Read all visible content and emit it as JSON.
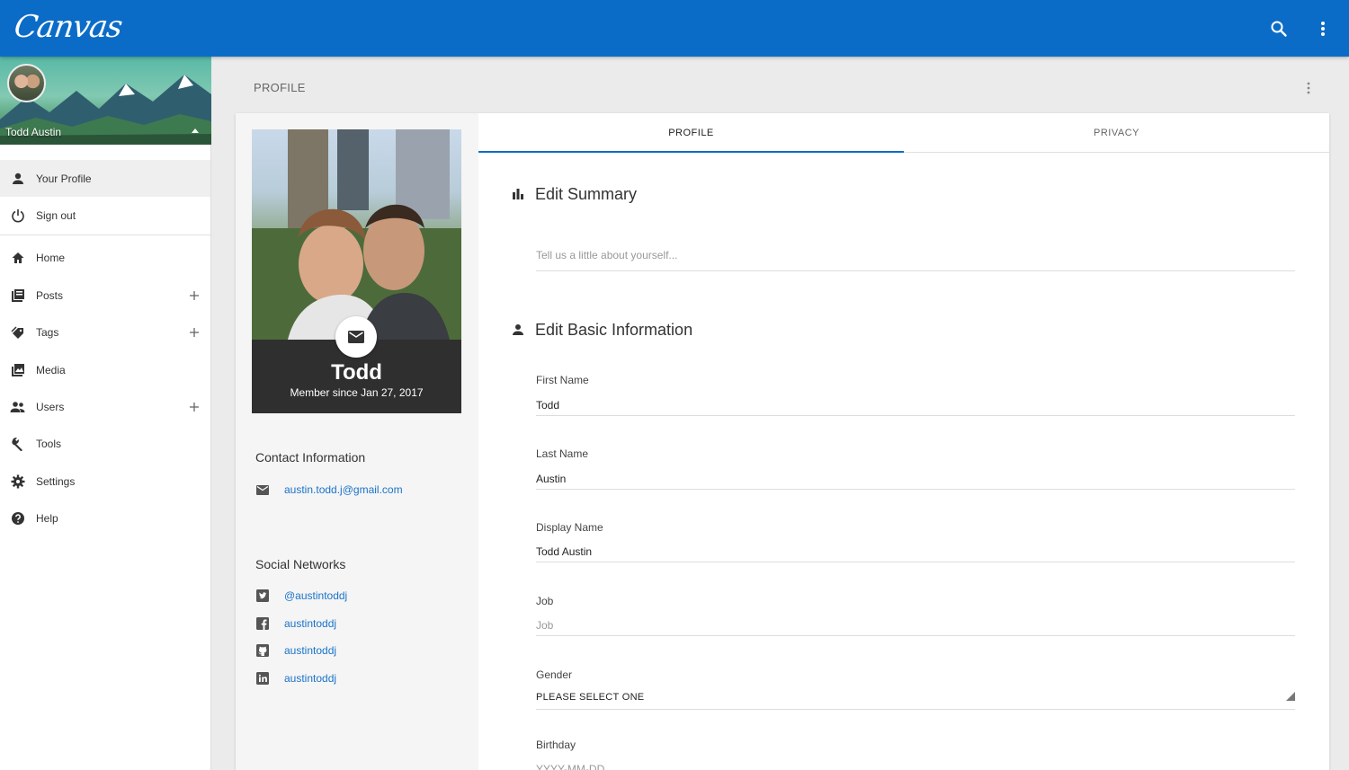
{
  "app": {
    "logo": "Canvas"
  },
  "icons": {
    "search": "search-icon",
    "more": "more-vert-icon"
  },
  "sidebar": {
    "user_name": "Todd Austin",
    "account": [
      {
        "label": "Your Profile",
        "icon": "person-icon",
        "active": true
      },
      {
        "label": "Sign out",
        "icon": "power-icon"
      }
    ],
    "items": [
      {
        "label": "Home",
        "icon": "home-icon"
      },
      {
        "label": "Posts",
        "icon": "posts-icon",
        "add": true
      },
      {
        "label": "Tags",
        "icon": "tags-icon",
        "add": true
      },
      {
        "label": "Media",
        "icon": "media-icon"
      },
      {
        "label": "Users",
        "icon": "users-icon",
        "add": true
      },
      {
        "label": "Tools",
        "icon": "wrench-icon"
      },
      {
        "label": "Settings",
        "icon": "gear-icon"
      },
      {
        "label": "Help",
        "icon": "help-icon"
      }
    ]
  },
  "page": {
    "title": "PROFILE"
  },
  "profile_card": {
    "name": "Todd",
    "member_since": "Member since Jan 27, 2017",
    "contact_heading": "Contact Information",
    "email": "austin.todd.j@gmail.com",
    "social_heading": "Social Networks",
    "social": [
      {
        "network": "twitter",
        "icon": "twitter-icon",
        "handle": "@austintoddj"
      },
      {
        "network": "facebook",
        "icon": "facebook-icon",
        "handle": "austintoddj"
      },
      {
        "network": "github",
        "icon": "github-icon",
        "handle": "austintoddj"
      },
      {
        "network": "linkedin",
        "icon": "linkedin-icon",
        "handle": "austintoddj"
      }
    ]
  },
  "tabs": [
    {
      "label": "PROFILE",
      "active": true
    },
    {
      "label": "PRIVACY",
      "active": false
    }
  ],
  "form": {
    "summary_heading": "Edit Summary",
    "summary_placeholder": "Tell us a little about yourself...",
    "basic_heading": "Edit Basic Information",
    "first_name_label": "First Name",
    "first_name_value": "Todd",
    "last_name_label": "Last Name",
    "last_name_value": "Austin",
    "display_name_label": "Display Name",
    "display_name_value": "Todd Austin",
    "job_label": "Job",
    "job_placeholder": "Job",
    "gender_label": "Gender",
    "gender_value": "PLEASE SELECT ONE",
    "birthday_label": "Birthday",
    "birthday_placeholder": "YYYY-MM-DD"
  },
  "colors": {
    "primary": "#0b6cc7",
    "link": "#1a73c8",
    "sidebar_active": "#efefef"
  }
}
